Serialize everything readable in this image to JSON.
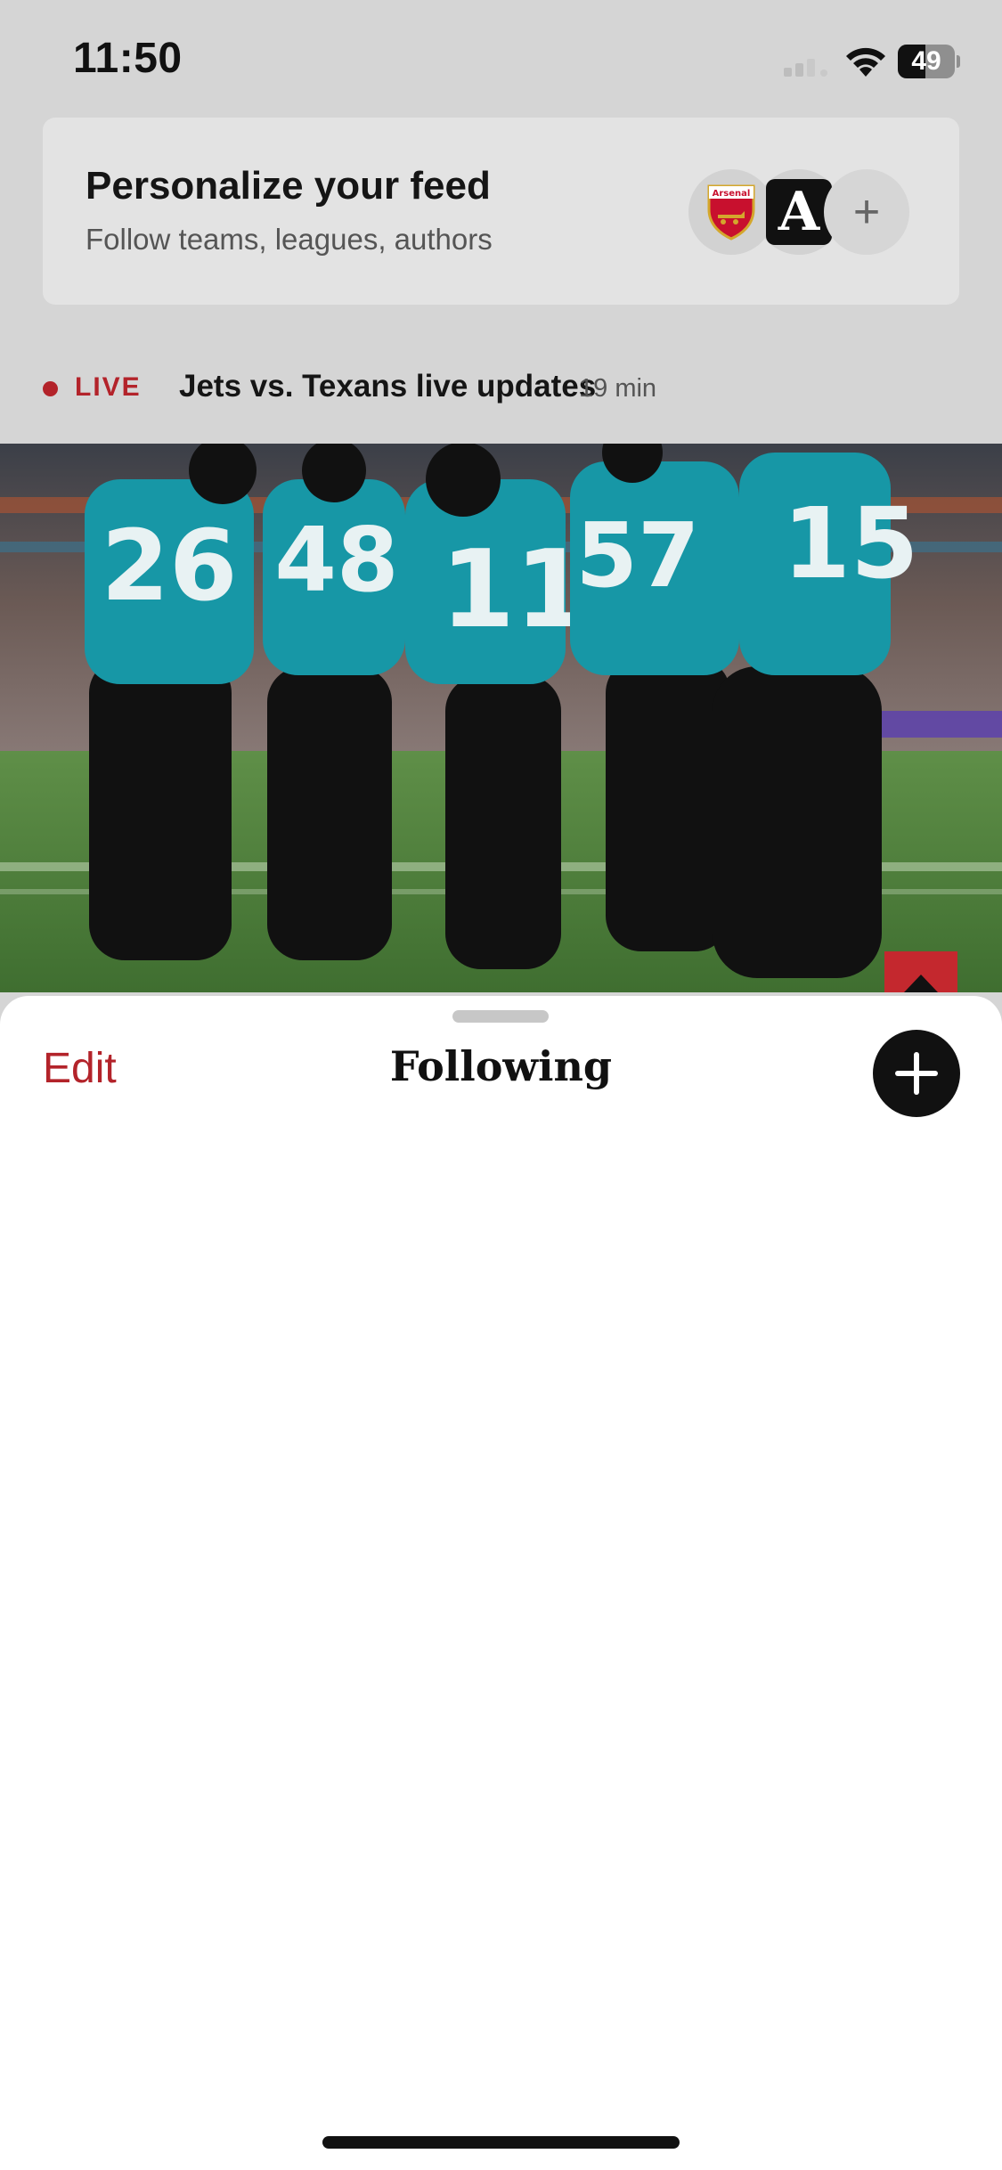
{
  "status_bar": {
    "time": "11:50",
    "battery_level": "49",
    "battery_fraction": 0.49
  },
  "personalize": {
    "title": "Personalize your feed",
    "subtitle": "Follow teams, leagues, authors",
    "avatars": [
      {
        "icon": "arsenal-crest-icon",
        "label": "Arsenal"
      },
      {
        "icon": "the-athletic-logo-icon",
        "label": "A"
      },
      {
        "icon": "plus-icon",
        "label": "+"
      }
    ]
  },
  "live": {
    "label": "LIVE",
    "headline": "Jets vs. Texans live updates",
    "time": "19 min",
    "accent_color": "#b3232a"
  },
  "hero": {
    "jersey_numbers": [
      "26",
      "48",
      "11",
      "57",
      "15"
    ],
    "jersey_color": "#1797a6"
  },
  "sheet": {
    "edit_label": "Edit",
    "title": "Following",
    "add_icon": "plus-icon"
  }
}
